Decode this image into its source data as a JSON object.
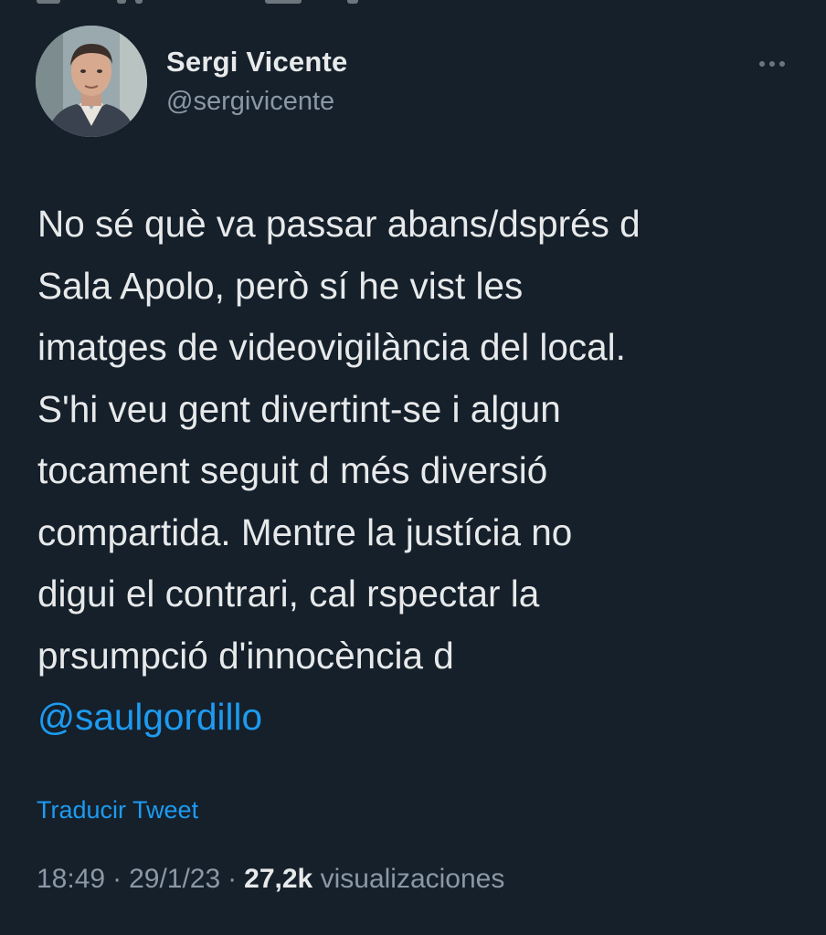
{
  "tweet": {
    "author": {
      "name": "Sergi Vicente",
      "handle": "@sergivicente"
    },
    "text_lines": [
      "No sé què va passar abans/dsprés d",
      "Sala Apolo, però sí he vist les",
      "imatges de videovigilància del local.",
      "S'hi veu gent divertint-se i algun",
      "tocament seguit d més diversió",
      "compartida. Mentre la justícia no",
      "digui el contrari, cal rspectar la",
      "prsumpció d'innocència d"
    ],
    "mention": "@saulgordillo",
    "translate_label": "Traducir Tweet",
    "time": "18:49",
    "date": "29/1/23",
    "separator": "·",
    "views_count": "27,2k",
    "views_label": "visualizaciones"
  },
  "icons": {
    "more": "more-options-icon"
  },
  "colors": {
    "background": "#15202b",
    "text": "#e7e9ea",
    "secondary": "#8b98a5",
    "accent": "#1d9bf0"
  }
}
